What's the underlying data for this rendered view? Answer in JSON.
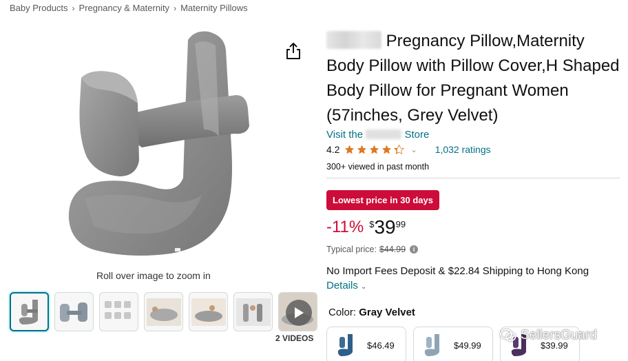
{
  "breadcrumb": {
    "items": [
      "Baby Products",
      "Pregnancy & Maternity",
      "Maternity Pillows"
    ],
    "separator": "›"
  },
  "gallery": {
    "zoom_hint": "Roll over image to zoom in",
    "videos_label": "2 VIDEOS",
    "thumbnail_count": 7,
    "active_index": 0
  },
  "product": {
    "title": "Pregnancy Pillow,Maternity Body Pillow with Pillow Cover,H Shaped Body Pillow for Pregnant Women (57inches, Grey Velvet)",
    "store_prefix": "Visit the",
    "store_suffix": "Store",
    "rating_value": "4.2",
    "rating_stars": 4.2,
    "ratings_count": "1,032 ratings",
    "viewed_text": "300+ viewed in past month"
  },
  "pricing": {
    "badge": "Lowest price in 30 days",
    "discount": "-11%",
    "currency": "$",
    "whole": "39",
    "fraction": "99",
    "typical_label": "Typical price:",
    "typical_value": "$44.99",
    "shipping": "No Import Fees Deposit & $22.84 Shipping to Hong Kong",
    "details": "Details"
  },
  "variation": {
    "label": "Color:",
    "value": "Gray Velvet",
    "swatches": [
      {
        "price": "$46.49",
        "color": "#2e5f8a"
      },
      {
        "price": "$49.99",
        "color": "#8fa5b5"
      },
      {
        "price": "$39.99",
        "color": "#4a2f5e"
      }
    ]
  },
  "watermark": "SellersGuard",
  "colors": {
    "link": "#007185",
    "deal_red": "#cc0c39",
    "star": "#de7921"
  }
}
